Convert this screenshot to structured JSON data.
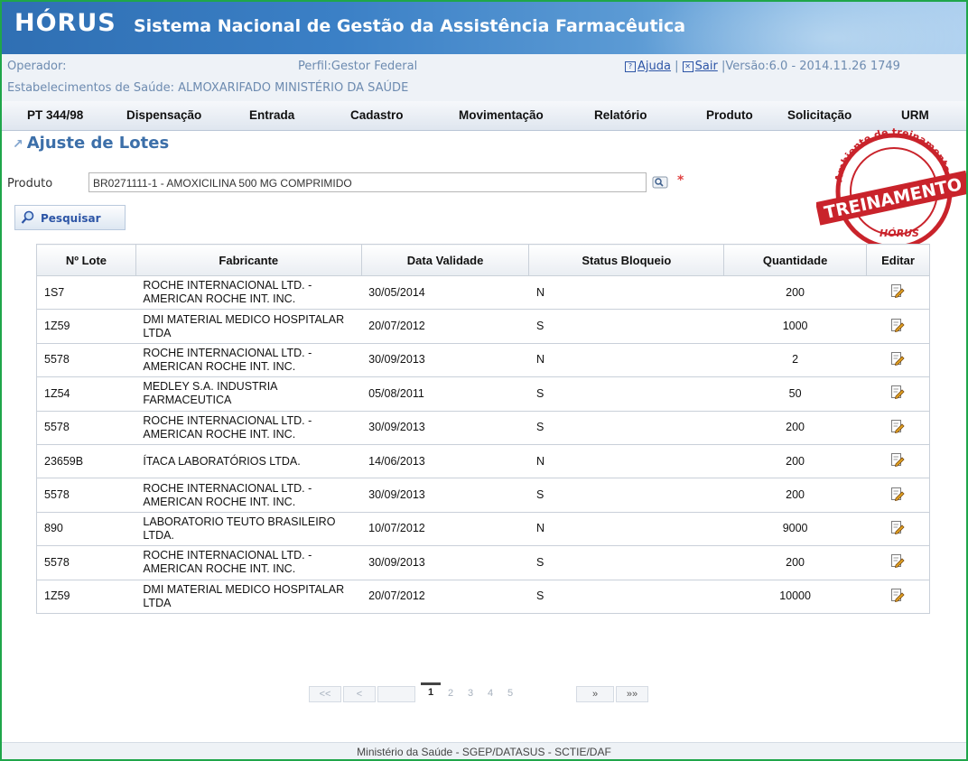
{
  "app": {
    "logo": "HÓRUS",
    "title": "Sistema Nacional de Gestão da Assistência Farmacêutica"
  },
  "info": {
    "operador": "Operador:",
    "perfil": "Perfil:Gestor Federal",
    "ajuda": "Ajuda",
    "sair": "Sair",
    "versao": "|Versão:6.0 - 2014.11.26 1749",
    "estabelecimento": "Estabelecimentos de Saúde: ALMOXARIFADO MINISTÉRIO DA SAÚDE"
  },
  "menu": {
    "items": [
      "PT 344/98",
      "Dispensação",
      "Entrada",
      "Cadastro",
      "Movimentação",
      "Relatório",
      "Produto",
      "Solicitação",
      "URM"
    ]
  },
  "page": {
    "title": "Ajuste de Lotes",
    "produto_label": "Produto",
    "produto_value": "BR0271111-1 - AMOXICILINA 500 MG COMPRIMIDO",
    "required_mark": "*",
    "search_button": "Pesquisar"
  },
  "stamp": {
    "top_text": "Ambiente de treinamento",
    "main_text": "TREINAMENTO",
    "bottom_text": "HÓRUS"
  },
  "table": {
    "headers": [
      "Nº Lote",
      "Fabricante",
      "Data Validade",
      "Status Bloqueio",
      "Quantidade",
      "Editar"
    ],
    "rows": [
      {
        "lote": "1S7",
        "fabricante": "ROCHE INTERNACIONAL LTD. - AMERICAN ROCHE INT. INC.",
        "validade": "30/05/2014",
        "status": "N",
        "quantidade": "200"
      },
      {
        "lote": "1Z59",
        "fabricante": "DMI MATERIAL MEDICO HOSPITALAR LTDA",
        "validade": "20/07/2012",
        "status": "S",
        "quantidade": "1000"
      },
      {
        "lote": "5578",
        "fabricante": "ROCHE INTERNACIONAL LTD. - AMERICAN ROCHE INT. INC.",
        "validade": "30/09/2013",
        "status": "N",
        "quantidade": "2"
      },
      {
        "lote": "1Z54",
        "fabricante": "MEDLEY S.A. INDUSTRIA FARMACEUTICA",
        "validade": "05/08/2011",
        "status": "S",
        "quantidade": "50"
      },
      {
        "lote": "5578",
        "fabricante": "ROCHE INTERNACIONAL LTD. - AMERICAN ROCHE INT. INC.",
        "validade": "30/09/2013",
        "status": "S",
        "quantidade": "200"
      },
      {
        "lote": "23659B",
        "fabricante": "ÍTACA LABORATÓRIOS LTDA.",
        "validade": "14/06/2013",
        "status": "N",
        "quantidade": "200"
      },
      {
        "lote": "5578",
        "fabricante": "ROCHE INTERNACIONAL LTD. - AMERICAN ROCHE INT. INC.",
        "validade": "30/09/2013",
        "status": "S",
        "quantidade": "200"
      },
      {
        "lote": "890",
        "fabricante": "LABORATORIO TEUTO BRASILEIRO LTDA.",
        "validade": "10/07/2012",
        "status": "N",
        "quantidade": "9000"
      },
      {
        "lote": "5578",
        "fabricante": "ROCHE INTERNACIONAL LTD. - AMERICAN ROCHE INT. INC.",
        "validade": "30/09/2013",
        "status": "S",
        "quantidade": "200"
      },
      {
        "lote": "1Z59",
        "fabricante": "DMI MATERIAL MEDICO HOSPITALAR LTDA",
        "validade": "20/07/2012",
        "status": "S",
        "quantidade": "10000"
      }
    ],
    "edit_icon": "edit-pencil-icon"
  },
  "pagination": {
    "first": "<<",
    "prev": "<",
    "pages": [
      "1",
      "2",
      "3",
      "4",
      "5"
    ],
    "current": "1",
    "next": "»",
    "last": "»»"
  },
  "footer": {
    "text": "Ministério da Saúde - SGEP/DATASUS - SCTIE/DAF"
  },
  "colors": {
    "frame_border": "#1fa64a",
    "banner": "#2f6fb3",
    "heading": "#3c6fa9",
    "stamp": "#c9232b"
  }
}
